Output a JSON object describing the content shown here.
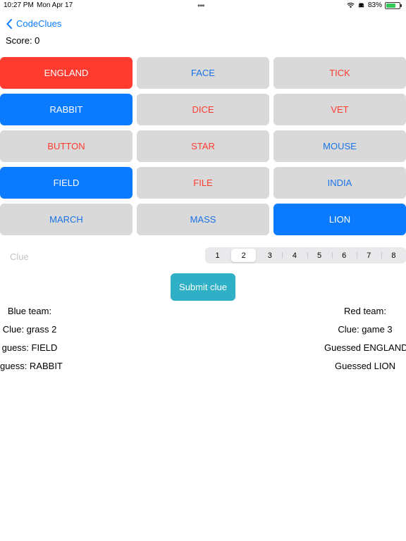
{
  "status_bar": {
    "time": "10:27 PM",
    "date": "Mon Apr 17",
    "battery_percent": "83%",
    "battery_level": 0.83
  },
  "nav": {
    "back_label": "CodeClues"
  },
  "score": "Score: 0",
  "board": [
    {
      "word": "ENGLAND",
      "state": "red-revealed"
    },
    {
      "word": "FACE",
      "state": "hidden-blue"
    },
    {
      "word": "TICK",
      "state": "hidden-red"
    },
    {
      "word": "RABBIT",
      "state": "blue-revealed"
    },
    {
      "word": "DICE",
      "state": "hidden-red"
    },
    {
      "word": "VET",
      "state": "hidden-red"
    },
    {
      "word": "BUTTON",
      "state": "hidden-red"
    },
    {
      "word": "STAR",
      "state": "hidden-red"
    },
    {
      "word": "MOUSE",
      "state": "hidden-blue"
    },
    {
      "word": "FIELD",
      "state": "blue-revealed"
    },
    {
      "word": "FILE",
      "state": "hidden-red"
    },
    {
      "word": "INDIA",
      "state": "hidden-blue"
    },
    {
      "word": "MARCH",
      "state": "hidden-blue"
    },
    {
      "word": "MASS",
      "state": "hidden-blue"
    },
    {
      "word": "LION",
      "state": "blue-revealed"
    }
  ],
  "clue": {
    "placeholder": "Clue",
    "value": ""
  },
  "number_picker": {
    "options": [
      "1",
      "2",
      "3",
      "4",
      "5",
      "6",
      "7",
      "8"
    ],
    "selected": "2"
  },
  "submit_label": "Submit clue",
  "blue_team": {
    "header": "Blue team:",
    "lines": [
      "Clue: grass 2",
      "guess: FIELD",
      "guess: RABBIT"
    ]
  },
  "red_team": {
    "header": "Red team:",
    "lines": [
      "Clue: game 3",
      "Guessed ENGLAND",
      "Guessed LION"
    ]
  },
  "colors": {
    "red": "#ff3b30",
    "blue": "#0a7aff",
    "card_bg": "#d9d9d9",
    "accent_teal": "#30b0c7"
  }
}
